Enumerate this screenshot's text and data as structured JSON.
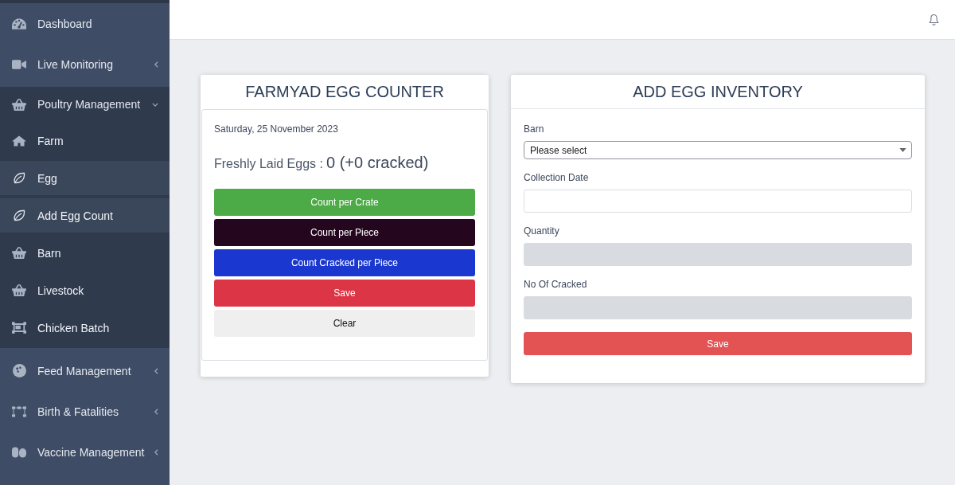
{
  "sidebar": {
    "items": [
      {
        "label": "Dashboard",
        "kind": "link"
      },
      {
        "label": "Live Monitoring",
        "kind": "group",
        "expanded": false
      },
      {
        "label": "Poultry Management",
        "kind": "group",
        "expanded": true,
        "children": [
          {
            "label": "Farm",
            "highlighted": false
          },
          {
            "label": "Egg",
            "highlighted": true
          },
          {
            "label": "Add Egg Count",
            "highlighted": true
          },
          {
            "label": "Barn",
            "highlighted": false
          },
          {
            "label": "Livestock",
            "highlighted": false
          },
          {
            "label": "Chicken Batch",
            "highlighted": false
          }
        ]
      },
      {
        "label": "Feed Management",
        "kind": "group",
        "expanded": false
      },
      {
        "label": "Birth & Fatalities",
        "kind": "group",
        "expanded": false
      },
      {
        "label": "Vaccine Management",
        "kind": "group",
        "expanded": false
      }
    ]
  },
  "egg_counter": {
    "title": "FARMYAD EGG COUNTER",
    "date": "Saturday, 25 November 2023",
    "eggs_label": "Freshly Laid Eggs :",
    "eggs_value": "0 (+0 cracked)",
    "buttons": [
      {
        "label": "Count per Crate",
        "color": "#4caa47"
      },
      {
        "label": "Count per Piece",
        "color": "#25061f"
      },
      {
        "label": "Count Cracked per Piece",
        "color": "#1a38cf"
      },
      {
        "label": "Save",
        "color": "#dc3545"
      },
      {
        "label": "Clear",
        "color": "#efefef"
      }
    ]
  },
  "inventory_form": {
    "title": "ADD EGG INVENTORY",
    "fields": [
      {
        "label": "Barn",
        "kind": "select",
        "value": "Please select",
        "disabled": false
      },
      {
        "label": "Collection Date",
        "kind": "input",
        "disabled": false
      },
      {
        "label": "Quantity",
        "kind": "input",
        "disabled": true
      },
      {
        "label": "No Of Cracked",
        "kind": "input",
        "disabled": true
      }
    ],
    "submit": "Save"
  }
}
